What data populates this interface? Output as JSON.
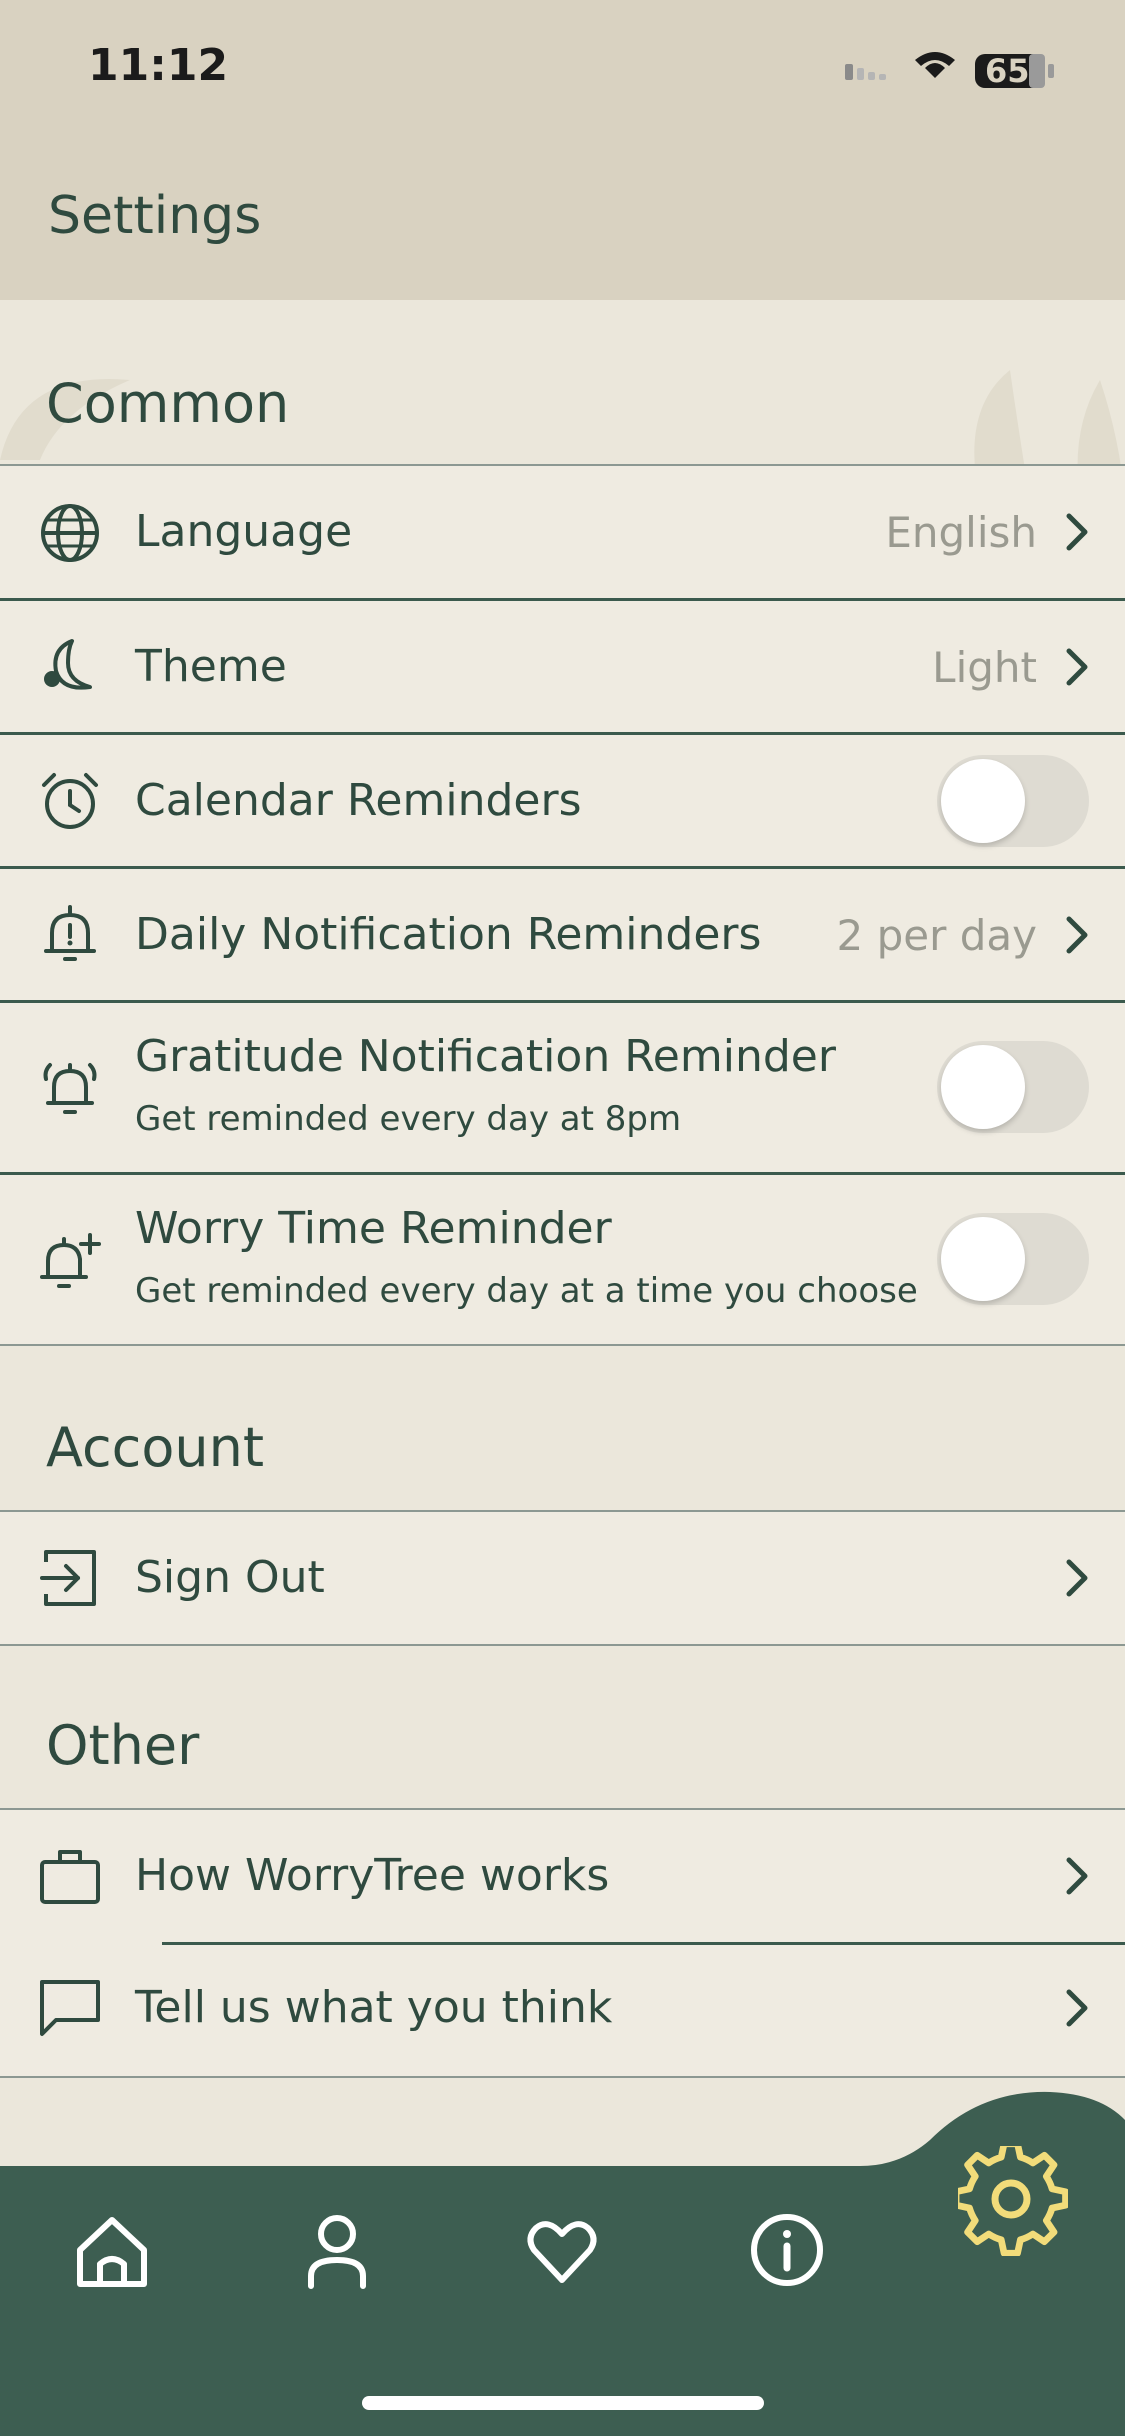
{
  "status_bar": {
    "time": "11:12",
    "battery": "65"
  },
  "header": {
    "title": "Settings"
  },
  "sections": {
    "common": {
      "title": "Common",
      "language": {
        "label": "Language",
        "value": "English"
      },
      "theme": {
        "label": "Theme",
        "value": "Light"
      },
      "calendar": {
        "label": "Calendar Reminders",
        "enabled": false
      },
      "daily": {
        "label": "Daily Notification Reminders",
        "value": "2 per day"
      },
      "gratitude": {
        "label": "Gratitude Notification Reminder",
        "subtitle": "Get reminded every day at 8pm",
        "enabled": false
      },
      "worry": {
        "label": "Worry Time Reminder",
        "subtitle": "Get reminded every day at a time you choose",
        "enabled": false
      }
    },
    "account": {
      "title": "Account",
      "sign_out": {
        "label": "Sign Out"
      }
    },
    "other": {
      "title": "Other",
      "how_works": {
        "label": "How WorryTree works"
      },
      "feedback": {
        "label": "Tell us what you think"
      }
    }
  },
  "tab_bar": {
    "items": [
      {
        "icon": "home-icon"
      },
      {
        "icon": "profile-icon"
      },
      {
        "icon": "heart-icon"
      },
      {
        "icon": "info-icon"
      },
      {
        "icon": "gear-icon",
        "active": true
      }
    ]
  },
  "colors": {
    "header_bg": "#d9d2c1",
    "content_bg": "#ebe7db",
    "text_primary": "#2f4a3f",
    "tab_bar_bg": "#3d5e51",
    "active_icon": "#f2dc7a"
  }
}
